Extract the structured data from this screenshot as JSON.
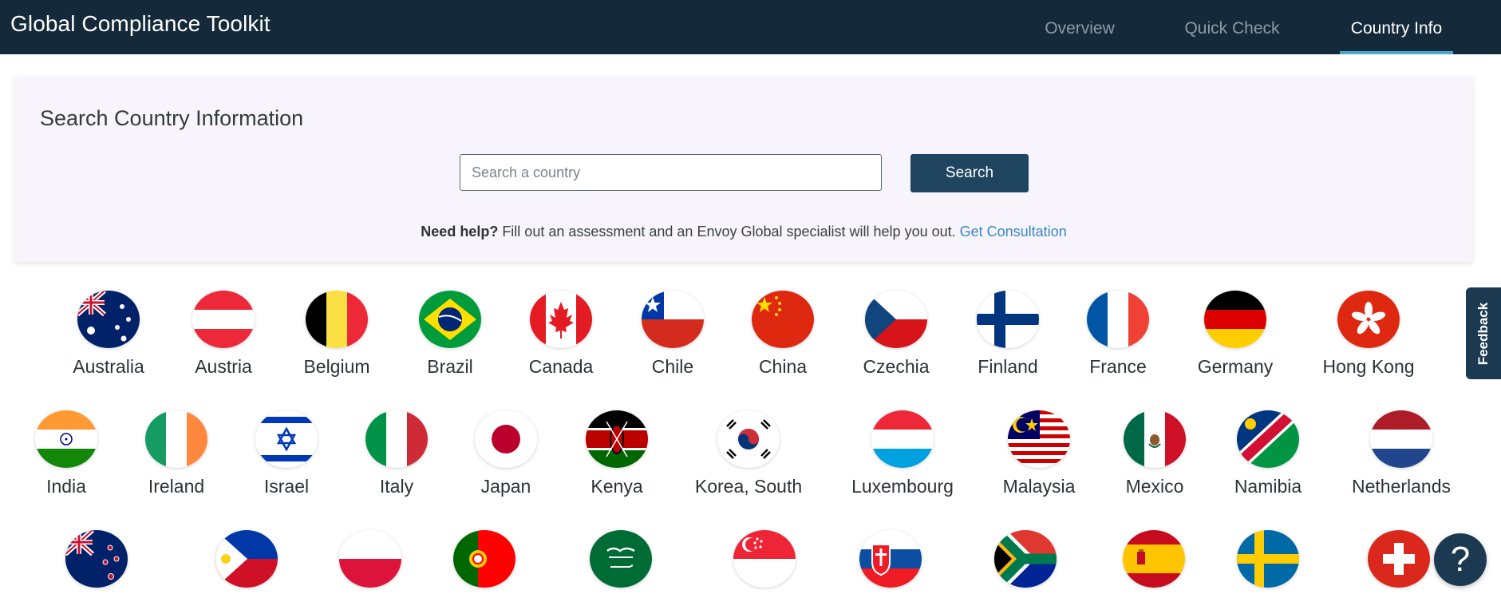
{
  "header": {
    "title": "Global Compliance Toolkit",
    "tabs": [
      {
        "label": "Overview",
        "active": false
      },
      {
        "label": "Quick Check",
        "active": false
      },
      {
        "label": "Country Info",
        "active": true
      }
    ],
    "accent_color": "#4aa6c8",
    "bg_color": "#142a3b"
  },
  "search": {
    "title": "Search Country Information",
    "placeholder": "Search a country",
    "value": "",
    "button_label": "Search",
    "help_bold": "Need help?",
    "help_text": " Fill out an assessment and an Envoy Global specialist will help you out. ",
    "help_link": "Get Consultation"
  },
  "countries": {
    "row1": [
      "Australia",
      "Austria",
      "Belgium",
      "Brazil",
      "Canada",
      "Chile",
      "China",
      "Czechia",
      "Finland",
      "France",
      "Germany",
      "Hong Kong"
    ],
    "row2": [
      "India",
      "Ireland",
      "Israel",
      "Italy",
      "Japan",
      "Kenya",
      "Korea, South",
      "Luxembourg",
      "Malaysia",
      "Mexico",
      "Namibia",
      "Netherlands"
    ]
  },
  "row3_flags": [
    "new-zealand-flag-icon",
    "philippines-flag-icon",
    "poland-flag-icon",
    "portugal-flag-icon",
    "saudi-arabia-flag-icon",
    "singapore-flag-icon",
    "slovakia-flag-icon",
    "south-africa-flag-icon",
    "spain-flag-icon",
    "sweden-flag-icon",
    "switzerland-flag-icon"
  ],
  "feedback_label": "Feedback",
  "help_bubble_icon": "question-mark-icon",
  "help_bubble_glyph": "?"
}
